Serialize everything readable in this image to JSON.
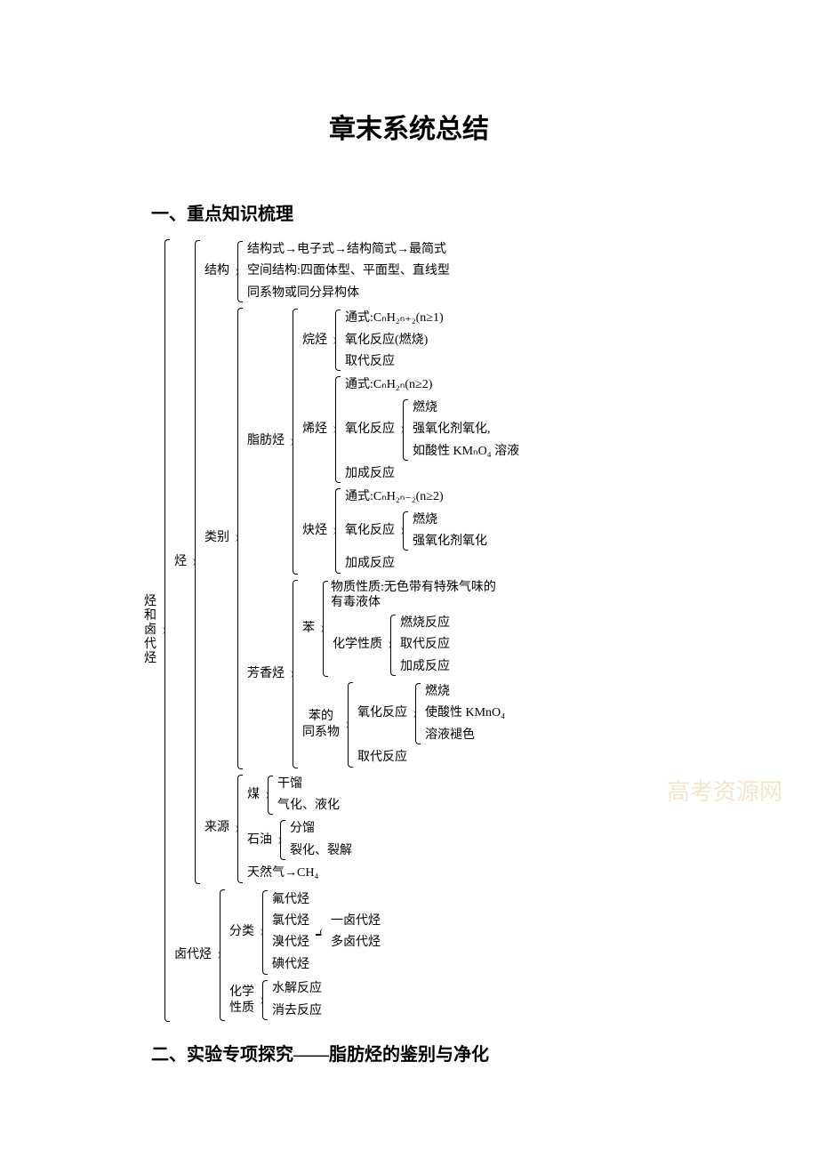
{
  "title": "章末系统总结",
  "section1": "一、重点知识梳理",
  "section2": "二、实验专项探究——脂肪烃的鉴别与净化",
  "watermark": "高考资源网",
  "root_label_chars": [
    "烃",
    "和",
    "卤",
    "代",
    "烃"
  ],
  "hydro_label": "烃",
  "struct_label": "结构",
  "struct_items": [
    "结构式→电子式→结构简式→最简式",
    "空间结构:四面体型、平面型、直线型",
    "同系物或同分异构体"
  ],
  "cat_label": "类别",
  "aliph_label": "脂肪烃",
  "alkane_label": "烷烃",
  "alkane_formula": "通式:CₙH₂ₙ₊₂(n≥1)",
  "alkane_ox": "氧化反应(燃烧)",
  "alkane_sub": "取代反应",
  "alkene_label": "烯烃",
  "alkene_formula": "通式:CₙH₂ₙ(n≥2)",
  "alkene_ox_label": "氧化反应",
  "alkene_ox_items": [
    "燃烧",
    "强氧化剂氧化,",
    "如酸性 KMₙO₄ 溶液"
  ],
  "alkene_add": "加成反应",
  "alkyne_label": "炔烃",
  "alkyne_formula": "通式:CₙH₂ₙ₋₂(n≥2)",
  "alkyne_ox_label": "氧化反应",
  "alkyne_ox_items": [
    "燃烧",
    "强氧化剂氧化"
  ],
  "alkyne_add": "加成反应",
  "arom_label": "芳香烃",
  "benz_label": "苯",
  "benz_phys_l1": "物质性质:无色带有特殊气味的",
  "benz_phys_l2": "有毒液体",
  "benz_chem_label": "化学性质",
  "benz_chem_items": [
    "燃烧反应",
    "取代反应",
    "加成反应"
  ],
  "homol_l1": "苯的",
  "homol_l2": "同系物",
  "homol_ox_label": "氧化反应",
  "homol_ox_items": [
    "燃烧",
    "使酸性 KMnO₄",
    "溶液褪色"
  ],
  "homol_sub": "取代反应",
  "source_label": "来源",
  "coal_label": "煤",
  "coal_items": [
    "干馏",
    "气化、液化"
  ],
  "oil_label": "石油",
  "oil_items": [
    "分馏",
    "裂化、裂解"
  ],
  "gas_leaf": "天然气→CH₄",
  "halo_label": "卤代烃",
  "halo_class_label": "分类",
  "halo_types": [
    "氟代烃",
    "氯代烃",
    "溴代烃",
    "碘代烃"
  ],
  "halo_right": [
    "一卤代烃",
    "多卤代烃"
  ],
  "halo_chem_l1": "化学",
  "halo_chem_l2": "性质",
  "halo_chem_items": [
    "水解反应",
    "消去反应"
  ]
}
